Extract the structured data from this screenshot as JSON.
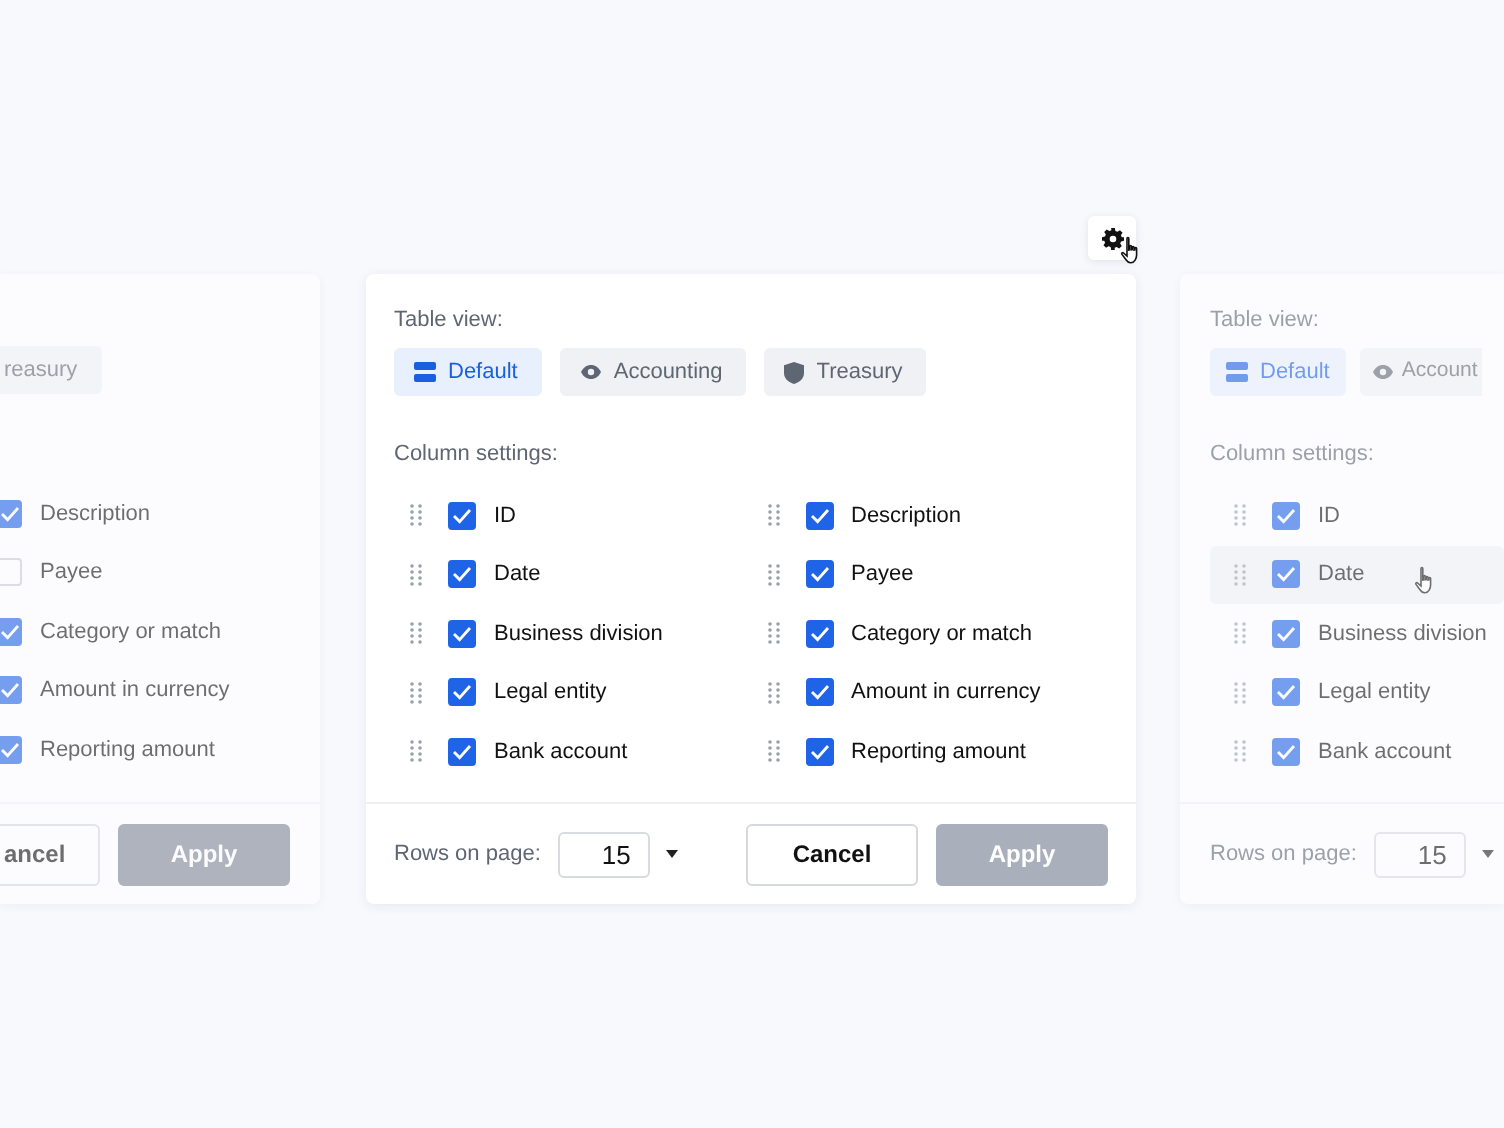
{
  "settings_button": {
    "hovered": true
  },
  "panels": [
    {
      "faded": true,
      "tabs": [
        {
          "label": "reasury",
          "selected": false
        }
      ],
      "columns": [
        [
          {
            "label": "Description",
            "checked": true
          },
          {
            "label": "Payee",
            "checked": false
          },
          {
            "label": "Category or match",
            "checked": true
          },
          {
            "label": "Amount in currency",
            "checked": true
          },
          {
            "label": "Reporting amount",
            "checked": true
          }
        ]
      ],
      "buttons": [
        {
          "label": "ancel",
          "kind": "secondary",
          "disabled": false
        },
        {
          "label": "Apply",
          "kind": "primary",
          "disabled": true
        }
      ]
    },
    {
      "faded": false,
      "table_view_label": "Table view:",
      "tabs": [
        {
          "label": "Default",
          "kind": "bars",
          "selected": true
        },
        {
          "label": "Accounting",
          "kind": "eye",
          "selected": false
        },
        {
          "label": "Treasury",
          "kind": "shield",
          "selected": false
        }
      ],
      "column_settings_label": "Column settings:",
      "columns": [
        [
          {
            "label": "ID",
            "checked": true
          },
          {
            "label": "Date",
            "checked": true
          },
          {
            "label": "Business division",
            "checked": true
          },
          {
            "label": "Legal entity",
            "checked": true
          },
          {
            "label": "Bank account",
            "checked": true
          }
        ],
        [
          {
            "label": "Description",
            "checked": true
          },
          {
            "label": "Payee",
            "checked": true
          },
          {
            "label": "Category or match",
            "checked": true
          },
          {
            "label": "Amount in currency",
            "checked": true
          },
          {
            "label": "Reporting amount",
            "checked": true
          }
        ]
      ],
      "rows_label": "Rows on page:",
      "rows_value": "15",
      "buttons": [
        {
          "label": "Cancel",
          "kind": "secondary",
          "disabled": false
        },
        {
          "label": "Apply",
          "kind": "primary",
          "disabled": true
        }
      ]
    },
    {
      "faded": true,
      "table_view_label": "Table view:",
      "tabs": [
        {
          "label": "Default",
          "kind": "bars",
          "selected": true
        },
        {
          "label": "Account",
          "kind": "eye",
          "selected": false
        }
      ],
      "column_settings_label": "Column settings:",
      "columns": [
        [
          {
            "label": "ID",
            "checked": true,
            "hovered": false
          },
          {
            "label": "Date",
            "checked": true,
            "hovered": true
          },
          {
            "label": "Business division",
            "checked": true,
            "hovered": false
          },
          {
            "label": "Legal entity",
            "checked": true,
            "hovered": false
          },
          {
            "label": "Bank account",
            "checked": true,
            "hovered": false
          }
        ]
      ],
      "rows_label": "Rows on page:",
      "rows_value": "15"
    }
  ]
}
